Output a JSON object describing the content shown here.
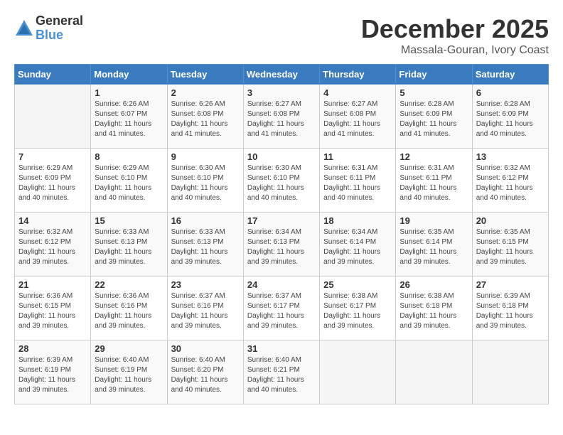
{
  "logo": {
    "general": "General",
    "blue": "Blue"
  },
  "header": {
    "month": "December 2025",
    "location": "Massala-Gouran, Ivory Coast"
  },
  "weekdays": [
    "Sunday",
    "Monday",
    "Tuesday",
    "Wednesday",
    "Thursday",
    "Friday",
    "Saturday"
  ],
  "weeks": [
    [
      {
        "day": "",
        "info": ""
      },
      {
        "day": "1",
        "info": "Sunrise: 6:26 AM\nSunset: 6:07 PM\nDaylight: 11 hours\nand 41 minutes."
      },
      {
        "day": "2",
        "info": "Sunrise: 6:26 AM\nSunset: 6:08 PM\nDaylight: 11 hours\nand 41 minutes."
      },
      {
        "day": "3",
        "info": "Sunrise: 6:27 AM\nSunset: 6:08 PM\nDaylight: 11 hours\nand 41 minutes."
      },
      {
        "day": "4",
        "info": "Sunrise: 6:27 AM\nSunset: 6:08 PM\nDaylight: 11 hours\nand 41 minutes."
      },
      {
        "day": "5",
        "info": "Sunrise: 6:28 AM\nSunset: 6:09 PM\nDaylight: 11 hours\nand 41 minutes."
      },
      {
        "day": "6",
        "info": "Sunrise: 6:28 AM\nSunset: 6:09 PM\nDaylight: 11 hours\nand 40 minutes."
      }
    ],
    [
      {
        "day": "7",
        "info": "Sunrise: 6:29 AM\nSunset: 6:09 PM\nDaylight: 11 hours\nand 40 minutes."
      },
      {
        "day": "8",
        "info": "Sunrise: 6:29 AM\nSunset: 6:10 PM\nDaylight: 11 hours\nand 40 minutes."
      },
      {
        "day": "9",
        "info": "Sunrise: 6:30 AM\nSunset: 6:10 PM\nDaylight: 11 hours\nand 40 minutes."
      },
      {
        "day": "10",
        "info": "Sunrise: 6:30 AM\nSunset: 6:10 PM\nDaylight: 11 hours\nand 40 minutes."
      },
      {
        "day": "11",
        "info": "Sunrise: 6:31 AM\nSunset: 6:11 PM\nDaylight: 11 hours\nand 40 minutes."
      },
      {
        "day": "12",
        "info": "Sunrise: 6:31 AM\nSunset: 6:11 PM\nDaylight: 11 hours\nand 40 minutes."
      },
      {
        "day": "13",
        "info": "Sunrise: 6:32 AM\nSunset: 6:12 PM\nDaylight: 11 hours\nand 40 minutes."
      }
    ],
    [
      {
        "day": "14",
        "info": "Sunrise: 6:32 AM\nSunset: 6:12 PM\nDaylight: 11 hours\nand 39 minutes."
      },
      {
        "day": "15",
        "info": "Sunrise: 6:33 AM\nSunset: 6:13 PM\nDaylight: 11 hours\nand 39 minutes."
      },
      {
        "day": "16",
        "info": "Sunrise: 6:33 AM\nSunset: 6:13 PM\nDaylight: 11 hours\nand 39 minutes."
      },
      {
        "day": "17",
        "info": "Sunrise: 6:34 AM\nSunset: 6:13 PM\nDaylight: 11 hours\nand 39 minutes."
      },
      {
        "day": "18",
        "info": "Sunrise: 6:34 AM\nSunset: 6:14 PM\nDaylight: 11 hours\nand 39 minutes."
      },
      {
        "day": "19",
        "info": "Sunrise: 6:35 AM\nSunset: 6:14 PM\nDaylight: 11 hours\nand 39 minutes."
      },
      {
        "day": "20",
        "info": "Sunrise: 6:35 AM\nSunset: 6:15 PM\nDaylight: 11 hours\nand 39 minutes."
      }
    ],
    [
      {
        "day": "21",
        "info": "Sunrise: 6:36 AM\nSunset: 6:15 PM\nDaylight: 11 hours\nand 39 minutes."
      },
      {
        "day": "22",
        "info": "Sunrise: 6:36 AM\nSunset: 6:16 PM\nDaylight: 11 hours\nand 39 minutes."
      },
      {
        "day": "23",
        "info": "Sunrise: 6:37 AM\nSunset: 6:16 PM\nDaylight: 11 hours\nand 39 minutes."
      },
      {
        "day": "24",
        "info": "Sunrise: 6:37 AM\nSunset: 6:17 PM\nDaylight: 11 hours\nand 39 minutes."
      },
      {
        "day": "25",
        "info": "Sunrise: 6:38 AM\nSunset: 6:17 PM\nDaylight: 11 hours\nand 39 minutes."
      },
      {
        "day": "26",
        "info": "Sunrise: 6:38 AM\nSunset: 6:18 PM\nDaylight: 11 hours\nand 39 minutes."
      },
      {
        "day": "27",
        "info": "Sunrise: 6:39 AM\nSunset: 6:18 PM\nDaylight: 11 hours\nand 39 minutes."
      }
    ],
    [
      {
        "day": "28",
        "info": "Sunrise: 6:39 AM\nSunset: 6:19 PM\nDaylight: 11 hours\nand 39 minutes."
      },
      {
        "day": "29",
        "info": "Sunrise: 6:40 AM\nSunset: 6:19 PM\nDaylight: 11 hours\nand 39 minutes."
      },
      {
        "day": "30",
        "info": "Sunrise: 6:40 AM\nSunset: 6:20 PM\nDaylight: 11 hours\nand 40 minutes."
      },
      {
        "day": "31",
        "info": "Sunrise: 6:40 AM\nSunset: 6:21 PM\nDaylight: 11 hours\nand 40 minutes."
      },
      {
        "day": "",
        "info": ""
      },
      {
        "day": "",
        "info": ""
      },
      {
        "day": "",
        "info": ""
      }
    ]
  ]
}
